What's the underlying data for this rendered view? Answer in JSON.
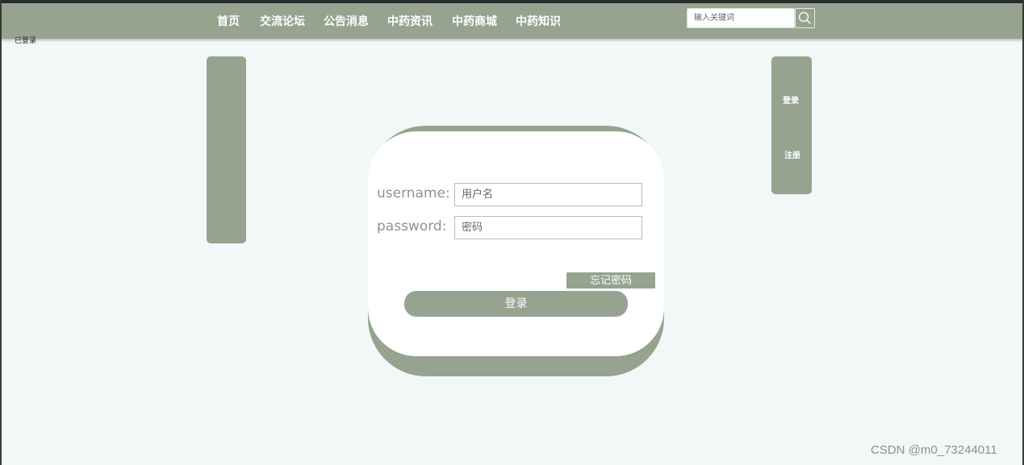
{
  "nav": {
    "items": [
      "首页",
      "交流论坛",
      "公告消息",
      "中药资讯",
      "中药商城",
      "中药知识"
    ],
    "search_placeholder": "输入关键词",
    "search_icon": "magnifier-icon"
  },
  "page_label": "已登录",
  "side_menu": {
    "login_label": "登录",
    "register_label": "注册"
  },
  "login_form": {
    "username_label": "username:",
    "username_placeholder": "用户名",
    "password_label": "password:",
    "password_placeholder": "密码",
    "forgot_label": "忘记密码",
    "submit_label": "登录"
  },
  "watermark": "CSDN @m0_73244011",
  "colors": {
    "accent": "#95a38f",
    "background": "#f2f7f8",
    "card": "#ffffff",
    "label_text": "#8b9584"
  }
}
